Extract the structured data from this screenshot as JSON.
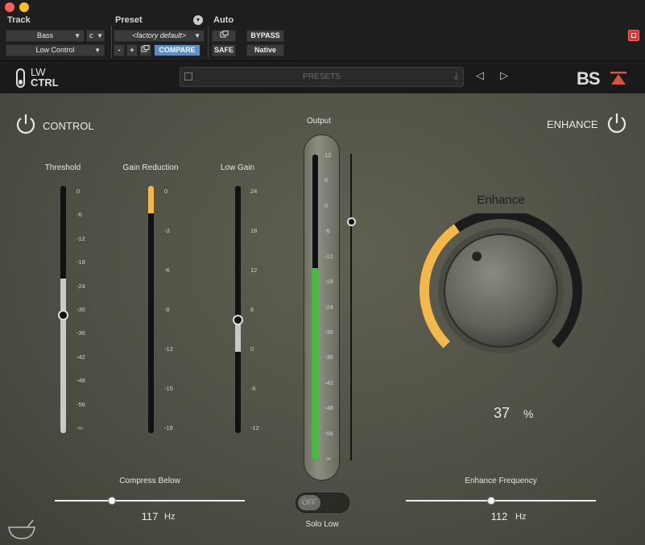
{
  "host": {
    "track_header": "Track",
    "preset_header": "Preset",
    "auto_header": "Auto",
    "track_name": "Bass",
    "channel": "c",
    "plugin_name": "Low Control",
    "preset_name": "<factory default>",
    "minus": "-",
    "plus": "+",
    "compare": "COMPARE",
    "bypass": "BYPASS",
    "safe": "SAFE",
    "native": "Native"
  },
  "plugin": {
    "logo_line1": "LW",
    "logo_line2": "CTRL",
    "presets_label": "PRESETS",
    "brand": "BS",
    "control_label": "CONTROL",
    "enhance_label": "ENHANCE",
    "output_label": "Output",
    "threshold": {
      "label": "Threshold",
      "scale": [
        "0",
        "-6",
        "-12",
        "-18",
        "-24",
        "-30",
        "-36",
        "-42",
        "-48",
        "-56",
        "-∞"
      ],
      "value_fraction": 0.52
    },
    "gain_reduction": {
      "label": "Gain Reduction",
      "scale": [
        "0",
        "-3",
        "-6",
        "-9",
        "-12",
        "-15",
        "-18"
      ],
      "value_fraction": 0.11
    },
    "low_gain": {
      "label": "Low Gain",
      "scale": [
        "24",
        "18",
        "12",
        "6",
        "0",
        "-6",
        "-12"
      ],
      "value_fraction": 0.54
    },
    "output": {
      "scale": [
        "12",
        "6",
        "0",
        "-6",
        "-12",
        "-18",
        "-24",
        "-30",
        "-36",
        "-42",
        "-48",
        "-56",
        "-∞"
      ],
      "meter_fraction": 0.63,
      "fader_fraction": 0.22
    },
    "enhance": {
      "title": "Enhance",
      "value": "37",
      "unit": "%",
      "fraction": 0.37,
      "frequency_label": "Enhance Frequency",
      "frequency_value": "112",
      "frequency_unit": "Hz",
      "frequency_fraction": 0.45
    },
    "compress": {
      "label": "Compress Below",
      "value": "117",
      "unit": "Hz",
      "fraction": 0.3
    },
    "solo": {
      "label": "Solo Low",
      "state": "OFF"
    },
    "colors": {
      "accent": "#f2b84b",
      "meter_green": "#3fbf3c",
      "compare_blue": "#5b8fc4"
    }
  }
}
